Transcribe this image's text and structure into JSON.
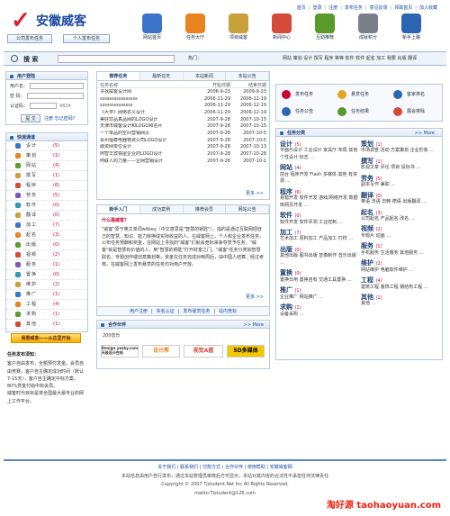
{
  "header": {
    "logo_text": "安徽威客",
    "logo_mark": "✓",
    "buttons": [
      "公司发布任务",
      "个人发布任务"
    ],
    "top_links": [
      "首页",
      "登录",
      "注册",
      "发布任务",
      "意见反馈",
      "领取首页",
      "加入收藏"
    ],
    "nav": [
      {
        "label": "网站首页",
        "color": "#3b74c8"
      },
      {
        "label": "任务大厅",
        "color": "#e8831f"
      },
      {
        "label": "项目威客",
        "color": "#c9a03a"
      },
      {
        "label": "新闻中心",
        "color": "#d64a3a"
      },
      {
        "label": "互助推荐",
        "color": "#5a9a2a"
      },
      {
        "label": "成就积分",
        "color": "#7a7f8a"
      },
      {
        "label": "新手上路",
        "color": "#2c66b3"
      }
    ]
  },
  "search": {
    "label": "搜 索",
    "hot_label": "热门：",
    "tags": "网站 策划 设计 撰写 程序 等等 软件 软件 起名 加工 我要 出版 翻译"
  },
  "login": {
    "title": "用户登陆",
    "username_label": "用户名：",
    "password_label": "密 码：",
    "code_label": "认证码：",
    "code_value": "4824",
    "submit": "提 交",
    "register": "注册",
    "forgot": "忘记密码?"
  },
  "channels": {
    "title": "快速通道",
    "items": [
      {
        "name": "设计",
        "count": "(5)",
        "color": "#3b74c8"
      },
      {
        "name": "策划",
        "count": "(1)",
        "color": "#e8831f"
      },
      {
        "name": "网站",
        "count": "(4)",
        "color": "#5a9a2a"
      },
      {
        "name": "撰写",
        "count": "(1)",
        "color": "#c9a03a"
      },
      {
        "name": "程序",
        "count": "(6)",
        "color": "#d64a3a"
      },
      {
        "name": "劳务",
        "count": "(5)",
        "color": "#7a5ab8"
      },
      {
        "name": "软件",
        "count": "(0)",
        "color": "#2c9ab0"
      },
      {
        "name": "翻译",
        "count": "(0)",
        "color": "#c9a03a"
      },
      {
        "name": "加工",
        "count": "(7)",
        "color": "#3b74c8"
      },
      {
        "name": "起名",
        "count": "(3)",
        "color": "#e8831f"
      },
      {
        "name": "出版",
        "count": "(0)",
        "color": "#5a9a2a"
      },
      {
        "name": "视频",
        "count": "(2)",
        "color": "#d64a3a"
      },
      {
        "name": "服务",
        "count": "(1)",
        "color": "#7a5ab8"
      },
      {
        "name": "置换",
        "count": "(0)",
        "color": "#2c9ab0"
      },
      {
        "name": "维护",
        "count": "(2)",
        "color": "#c9a03a"
      },
      {
        "name": "推广",
        "count": "(1)",
        "color": "#3b74c8"
      },
      {
        "name": "工程",
        "count": "(4)",
        "color": "#e8831f"
      },
      {
        "name": "求购",
        "count": "(1)",
        "color": "#5a9a2a"
      },
      {
        "name": "其他",
        "count": "(1)",
        "color": "#d64a3a"
      }
    ],
    "post_button": "我要威客——从这里开始"
  },
  "notes": {
    "title": "任务发布须知：",
    "p1": "客户自由发布，全额预付发金。会员自由竞赛，客户自主确定成功时间（默认7-15天），客户自主确定中标方案，80%赏金付给中标会员。",
    "p2": "威客时代目标是将全国最大最专业的网上工作平台。"
  },
  "tasks": {
    "tabs": [
      "推荐任务",
      "最新任务",
      "本站新闻",
      "本站公告"
    ],
    "columns": [
      "任务名称",
      "开始日期",
      "结束日期"
    ],
    "rows": [
      [
        "寻找威客设计网",
        "2006-9-23",
        "2009-9-23"
      ],
      [
        "ssssssssssssssss",
        "2006-11-29",
        "2006-12-19"
      ],
      [
        "ssssssssssssss",
        "2006-11-29",
        "2006-12-19"
      ],
      [
        "《大学》网络名义设计",
        "2006-11-29",
        "2006-12-19"
      ],
      [
        "美好饮品真品网的LOGO设计",
        "2007-9-28",
        "2007-10-15"
      ],
      [
        "天津市威客设计和LOGO和名片",
        "2007-9-28",
        "2007-10-15"
      ],
      [
        "一个单品的空间营销网页",
        "2007-9-28",
        "2007-10-5"
      ],
      [
        "贵州福泰电器物资公司LOGO设计",
        "2007-9-28",
        "2007-10-5"
      ],
      [
        "融资网单位设计",
        "2007-9-28",
        "2007-10-13"
      ],
      [
        "阿智华宾铁屋企业的LOGO设计",
        "2007-9-28",
        "2007-10-28"
      ],
      [
        "阿联人的力量——企网营销设计",
        "2007-9-28",
        "2007-10-1"
      ]
    ],
    "more": "更多 >>"
  },
  "help": {
    "tabs": [
      "新手入门",
      "成功案例",
      "推荐会员",
      "网站公告"
    ],
    "question": "什么是威客？",
    "answer": "\"威客\"原于英文单词witkey（中文意思是\"智慧的钥匙\"），指的是通过互联网把自己的智慧、知识、能力转换成实际收益的人。在威客网上，个人和企业发布任务，公布任务预酬和奖金，在网站上寻找的\"威客\"们就会竞标来争夺赏予任务。\"威客\"就是智慧有价值的人，用\"智慧的钥匙\"打开财富之门。\"威客\"任务分类如智慧取名，专题创作或创意策划等。资金在任务完成对两周后，由中国人结算。经过考核，在威客网上发布悬赏的任务均对用户开放。",
    "more": "更多 >>",
    "foot": [
      "用户注册",
      "实名认证",
      "发布悬赏任务",
      "站内竞标"
    ]
  },
  "partners": {
    "title": "合作伙伴",
    "more": ">> More",
    "count_text": "200音乐",
    "logos": [
      "Design.yesky.com 天极设计在线",
      "设计帮",
      "视觉A盟",
      "5D多媒体"
    ]
  },
  "quick": {
    "buttons": [
      {
        "label": "发布任务",
        "color": "#c03"
      },
      {
        "label": "悬赏任务",
        "color": "#e8a31f"
      },
      {
        "label": "客家排名",
        "color": "#2c66b3"
      },
      {
        "label": "任务公告",
        "color": "#2c66b3"
      },
      {
        "label": "任务结果",
        "color": "#5a9a2a"
      },
      {
        "label": "展会排除",
        "color": "#d64a3a"
      }
    ]
  },
  "categories": {
    "title": "任务分类",
    "more": ">> More",
    "left": [
      {
        "name": "设计",
        "count": "(5)",
        "items": "平面与设计 工业设计 家具厅 布局 其他 个性设计 标志 …"
      },
      {
        "name": "网站",
        "count": "(4)",
        "items": "前台 程序开发 Flash 多媒体 其他 有资源 …"
      },
      {
        "name": "程序",
        "count": "(6)",
        "items": "易错开发 软件开发 游戏/网络开发 数据库网页开发 …"
      },
      {
        "name": "软件",
        "count": "(0)",
        "items": "软件开发 软件评测 工业控制 …"
      },
      {
        "name": "加工",
        "count": "(7)",
        "items": "艺术加工 原料加工 产品加工 打样 …"
      },
      {
        "name": "出版",
        "count": "(0)",
        "items": "其他出版 图书出版 音像制作 音乐出版 …"
      },
      {
        "name": "置换",
        "count": "(0)",
        "items": "置换日用 置换自有 交通工具置换 …"
      },
      {
        "name": "推广",
        "count": "(1)",
        "items": "企业推广 网站推广 …"
      },
      {
        "name": "求购",
        "count": "(1)",
        "items": "设备采购 …"
      }
    ],
    "right": [
      {
        "name": "策划",
        "count": "(1)",
        "items": "市场调查 活动 方案策划 企业形象 …"
      },
      {
        "name": "撰写",
        "count": "(1)",
        "items": "影视文章 评论 项目 投标书 …"
      },
      {
        "name": "劳务",
        "count": "(5)",
        "items": "副本写作 兼职 …"
      },
      {
        "name": "翻译",
        "count": "(0)",
        "items": "英语 法语 日韩 德语 出版翻译 …"
      },
      {
        "name": "起名",
        "count": "(3)",
        "items": "公司起名 产品起名 改名 …"
      },
      {
        "name": "视频",
        "count": "(2)",
        "items": "专题片 动画 …"
      },
      {
        "name": "服务",
        "count": "(1)",
        "items": "手机服务 生活服务 其他服务 …"
      },
      {
        "name": "维护",
        "count": "(2)",
        "items": "网站维护 电脑软件维护 …"
      },
      {
        "name": "工程",
        "count": "(4)",
        "items": "建筑工程 装饰工程 钢结构工程 …"
      },
      {
        "name": "其他",
        "count": "(1)",
        "items": "其他 …"
      }
    ]
  },
  "footer": {
    "links": [
      "关于我们",
      "联系我们",
      "付款方式",
      "合作伙伴",
      "使用帮助",
      "安徽威客网"
    ],
    "line2": "本站信息由用户自行发布，通过本站管理员审核后方可显示，本站对其内容的合法性不承担任何法律责任",
    "line3": "Copyright © 2007 Tjstudent.Net Inc All Rights Reserved.",
    "line4": "mailto:Tjstudent@126.com",
    "watermark": "淘好源 taohaoyuan.com"
  }
}
